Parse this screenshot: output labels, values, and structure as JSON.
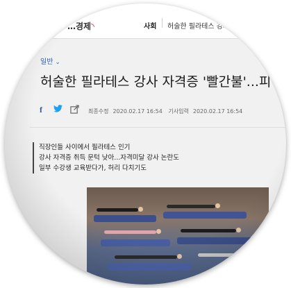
{
  "header": {
    "logo_text": "…경제",
    "section": "사회",
    "article_title_short": "허술한 필라테스 강사"
  },
  "article": {
    "category": "일반",
    "title": "허술한 필라테스 강사 자격증 '빨간불'...피",
    "modified_label": "최종수정",
    "modified_date": "2020.02.17 16:54",
    "published_label": "기사입력",
    "published_date": "2020.02.17 16:54",
    "summary": [
      "직장인들 사이에서 필라테스 인기",
      "강사 자격증 취득 문턱 낮아...자격미달 강사 논란도",
      "일부 수강생 교육받다가, 허리 다치기도"
    ]
  },
  "icons": [
    "facebook-icon",
    "twitter-icon",
    "share-icon",
    "chevron-down-icon"
  ],
  "colors": {
    "category": "#2a5db0",
    "facebook": "#3b5998",
    "twitter": "#1da1f2",
    "logo_accent": "#d0021b"
  }
}
